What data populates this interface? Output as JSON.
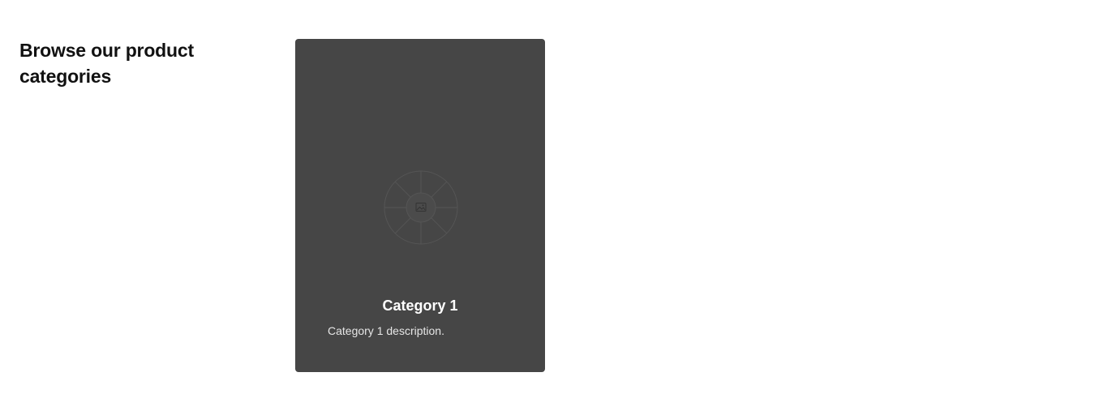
{
  "section": {
    "heading": "Browse our product categories"
  },
  "categories": [
    {
      "title": "Category 1",
      "description": "Category 1 description.",
      "image_icon": "image-placeholder-icon"
    }
  ],
  "colors": {
    "page_background": "#ffffff",
    "heading_text": "#111111",
    "card_background": "#464646",
    "card_title": "#ffffff",
    "card_description": "#e6e6e6"
  }
}
